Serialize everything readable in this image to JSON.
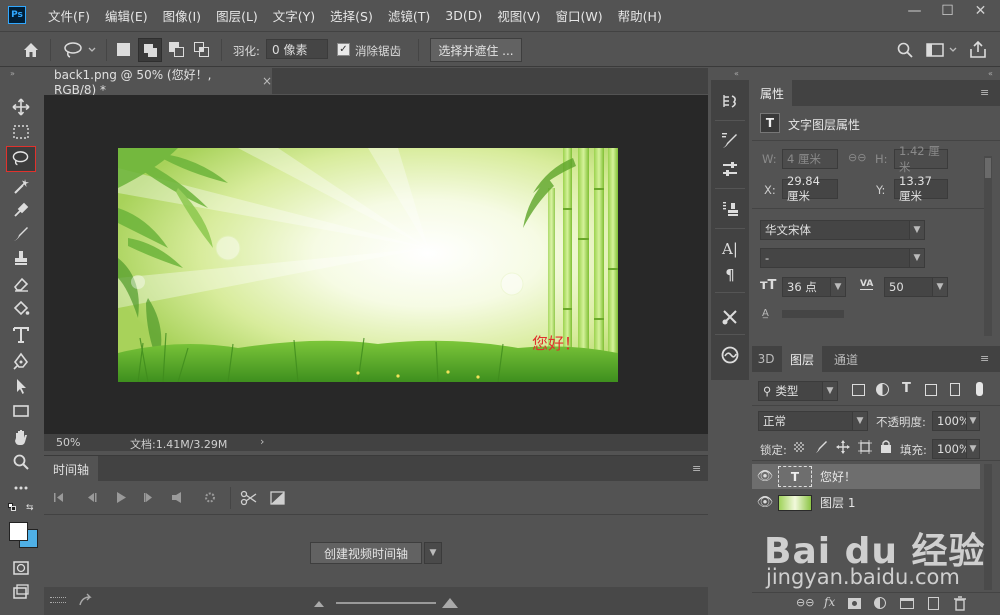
{
  "app": {
    "logo": "Ps"
  },
  "menu": [
    "文件(F)",
    "编辑(E)",
    "图像(I)",
    "图层(L)",
    "文字(Y)",
    "选择(S)",
    "滤镜(T)",
    "3D(D)",
    "视图(V)",
    "窗口(W)",
    "帮助(H)"
  ],
  "window_controls": {
    "minimize": "—",
    "maximize": "☐",
    "close": "✕"
  },
  "options": {
    "feather_label": "羽化:",
    "feather_value": "0 像素",
    "antialias_label": "消除锯齿",
    "antialias_checked": true,
    "select_mask_button": "选择并遮住 ..."
  },
  "document": {
    "tab_title": "back1.png @ 50% (您好！, RGB/8) *",
    "tab_close": "×",
    "canvas_text": "您好！",
    "zoom": "50%",
    "doc_size": "文档:1.41M/3.29M"
  },
  "timeline": {
    "tab_label": "时间轴",
    "create_button": "创建视频时间轴"
  },
  "properties": {
    "tab_label": "属性",
    "header": "文字图层属性",
    "w_label": "W:",
    "w_value": "4 厘米",
    "h_label": "H:",
    "h_value": "1.42 厘米",
    "x_label": "X:",
    "x_value": "29.84 厘米",
    "y_label": "Y:",
    "y_value": "13.37 厘米",
    "font_family": "华文宋体",
    "font_style": "-",
    "font_size": "36 点",
    "tracking": "50"
  },
  "layers": {
    "tabs": [
      "3D",
      "图层",
      "通道"
    ],
    "filter_kind": "类型",
    "blend_mode": "正常",
    "opacity_label": "不透明度:",
    "opacity_value": "100%",
    "lock_label": "锁定:",
    "fill_label": "填充:",
    "fill_value": "100%",
    "items": [
      {
        "name": "您好！",
        "type": "text",
        "selected": true
      },
      {
        "name": "图层 1",
        "type": "image",
        "selected": false
      }
    ]
  },
  "watermark": {
    "brand": "Bai du 经验",
    "url": "jingyan.baidu.com"
  },
  "colors": {
    "ui_bg": "#535353",
    "panel_dark": "#424242",
    "canvas_bg": "#282828",
    "accent_red": "#e0322d",
    "ps_blue": "#31a8ff",
    "background_swatch": "#4fb0e6",
    "foreground_swatch": "#ffffff"
  }
}
